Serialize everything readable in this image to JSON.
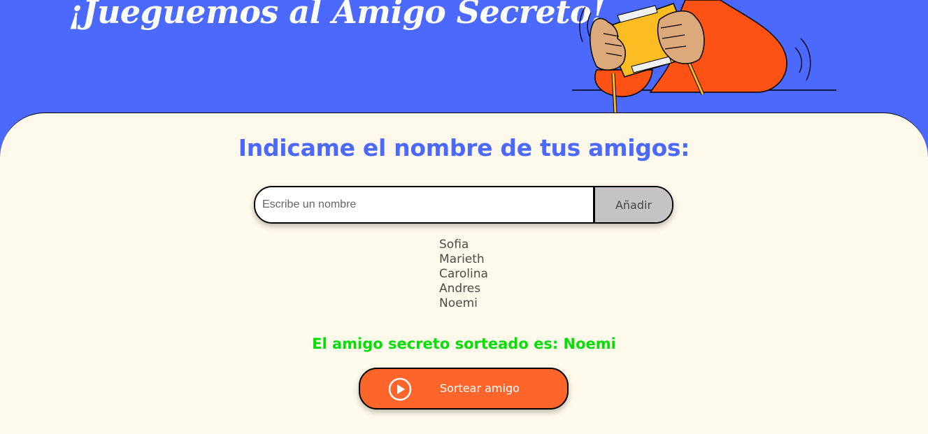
{
  "header": {
    "title": "¡Jueguemos al Amigo Secreto!",
    "illustration_icon": "person-holding-gift-illustration"
  },
  "main": {
    "section_title": "Indicame el nombre de tus amigos:",
    "input": {
      "placeholder": "Escribe un nombre",
      "value": ""
    },
    "add_button_label": "Añadir",
    "friends": [
      "Sofia",
      "Marieth",
      "Carolina",
      "Andres",
      "Noemi"
    ],
    "result_text": "El amigo secreto sorteado es: Noemi",
    "draw_button_label": "Sortear amigo",
    "draw_button_icon": "play-circle-icon"
  },
  "colors": {
    "header_background": "#4b69fd",
    "main_background": "#fff9eb",
    "title_blue": "#4b69fd",
    "add_button_gray": "#c4c4c4",
    "result_green": "#05df05",
    "draw_button_orange": "#fe652b"
  }
}
